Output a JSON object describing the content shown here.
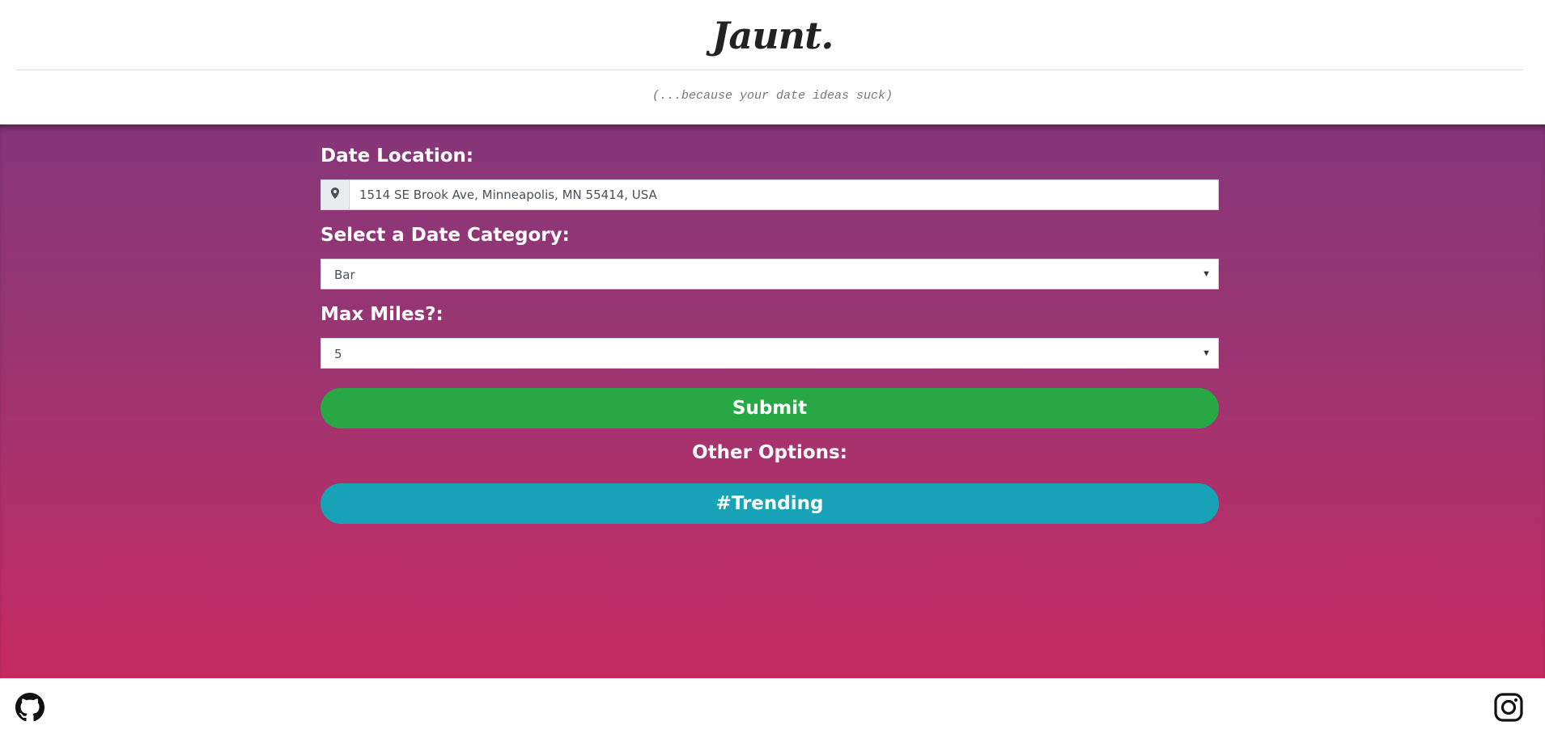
{
  "header": {
    "logo": "Jaunt.",
    "tagline": "(...because your date ideas suck)"
  },
  "form": {
    "location_label": "Date Location:",
    "location_icon": "map-marker-icon",
    "location_value": "1514 SE Brook Ave, Minneapolis, MN 55414, USA",
    "category_label": "Select a Date Category:",
    "category_value": "Bar",
    "miles_label": "Max Miles?:",
    "miles_value": "5",
    "submit_label": "Submit",
    "other_options_label": "Other Options:",
    "trending_label": "#Trending"
  },
  "footer": {
    "left_icon": "github-icon",
    "right_icon": "instagram-icon"
  },
  "colors": {
    "gradient_top": "#863679",
    "gradient_bottom": "#c52a5f",
    "submit": "#28a745",
    "trending": "#17a2b8"
  }
}
